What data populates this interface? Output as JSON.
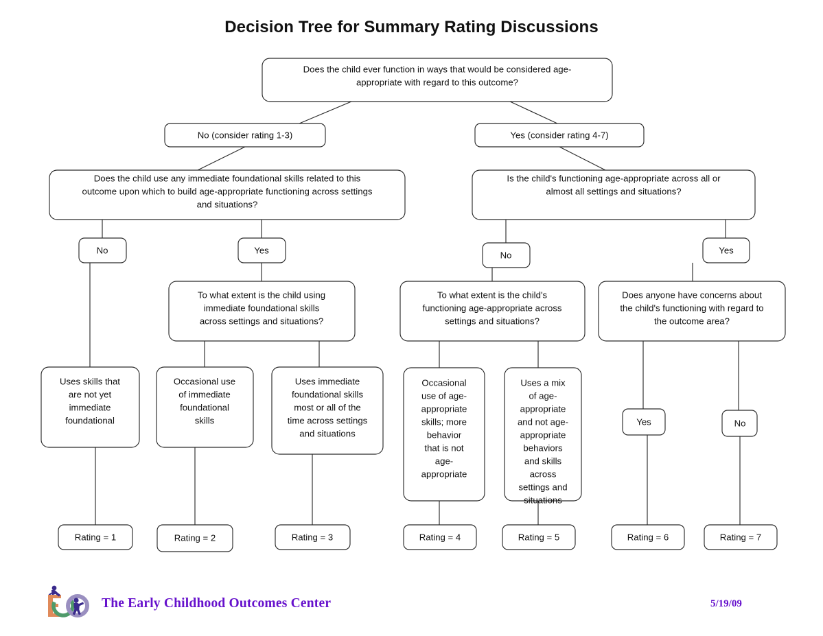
{
  "page": {
    "title": "Decision Tree for Summary Rating Discussions"
  },
  "footer": {
    "organization": "The Early Childhood Outcomes Center",
    "date": "5/19/09",
    "logo_name": "eco-logo",
    "brand_color": "#6611cc",
    "logo_colors": {
      "e": "#e08a5a",
      "c": "#4f9a6a",
      "o": "#9a8fc0",
      "figure": "#3a2a8c"
    }
  },
  "diagram": {
    "type": "decision-tree",
    "line_color": "#2b2b2b",
    "box_fill": "#ffffff",
    "nodes": {
      "root": {
        "id": "root",
        "lines": [
          "Does the child ever function in ways that would be considered age-",
          "appropriate with regard to this outcome?"
        ]
      },
      "branch_no": {
        "id": "branch-no",
        "lines": [
          "No (consider rating 1-3)"
        ]
      },
      "branch_yes": {
        "id": "branch-yes",
        "lines": [
          "Yes (consider rating 4-7)"
        ]
      },
      "q_left": {
        "id": "question-foundational-skills",
        "lines": [
          "Does the child use any immediate foundational skills related to this",
          "outcome upon which to build age-appropriate functioning across settings",
          "and situations?"
        ]
      },
      "q_right": {
        "id": "question-age-appropriate-all-settings",
        "lines": [
          "Is the child's functioning age-appropriate across all or",
          "almost all settings and situations?"
        ]
      },
      "l_no": {
        "id": "answer-no-left",
        "lines": [
          "No"
        ]
      },
      "l_yes": {
        "id": "answer-yes-left",
        "lines": [
          "Yes"
        ]
      },
      "r_no": {
        "id": "answer-no-right",
        "lines": [
          "No"
        ]
      },
      "r_yes": {
        "id": "answer-yes-right",
        "lines": [
          "Yes"
        ]
      },
      "q_extent_left": {
        "id": "question-extent-foundational",
        "lines": [
          "To what extent is the child using",
          "immediate foundational skills",
          "across settings and situations?"
        ]
      },
      "q_extent_right": {
        "id": "question-extent-age-appropriate",
        "lines": [
          "To what extent is the child's",
          "functioning age-appropriate across",
          "settings and situations?"
        ]
      },
      "q_concerns": {
        "id": "question-concerns",
        "lines": [
          "Does anyone have concerns about",
          "the child's functioning with regard to",
          "the outcome area?"
        ]
      },
      "desc1": {
        "id": "description-rating-1",
        "lines": [
          "Uses skills that",
          "are not yet",
          "immediate",
          "foundational"
        ]
      },
      "desc2": {
        "id": "description-rating-2",
        "lines": [
          "Occasional use",
          "of immediate",
          "foundational",
          "skills"
        ]
      },
      "desc3": {
        "id": "description-rating-3",
        "lines": [
          "Uses immediate",
          "foundational skills",
          "most or all of the",
          "time across settings",
          "and situations"
        ]
      },
      "desc4": {
        "id": "description-rating-4",
        "lines": [
          "Occasional",
          "use of age-",
          "appropriate",
          "skills; more",
          "behavior",
          "that is not",
          "age-",
          "appropriate"
        ]
      },
      "desc5": {
        "id": "description-rating-5",
        "lines": [
          "Uses a mix",
          "of age-",
          "appropriate",
          "and not age-",
          "appropriate",
          "behaviors",
          "and skills",
          "across",
          "settings and",
          "situations"
        ]
      },
      "concern_yes": {
        "id": "answer-yes-concerns",
        "lines": [
          "Yes"
        ]
      },
      "concern_no": {
        "id": "answer-no-concerns",
        "lines": [
          "No"
        ]
      },
      "rating1": {
        "id": "rating-1",
        "lines": [
          "Rating = 1"
        ]
      },
      "rating2": {
        "id": "rating-2",
        "lines": [
          "Rating = 2"
        ]
      },
      "rating3": {
        "id": "rating-3",
        "lines": [
          "Rating = 3"
        ]
      },
      "rating4": {
        "id": "rating-4",
        "lines": [
          "Rating = 4"
        ]
      },
      "rating5": {
        "id": "rating-5",
        "lines": [
          "Rating = 5"
        ]
      },
      "rating6": {
        "id": "rating-6",
        "lines": [
          "Rating = 6"
        ]
      },
      "rating7": {
        "id": "rating-7",
        "lines": [
          "Rating = 7"
        ]
      }
    }
  }
}
